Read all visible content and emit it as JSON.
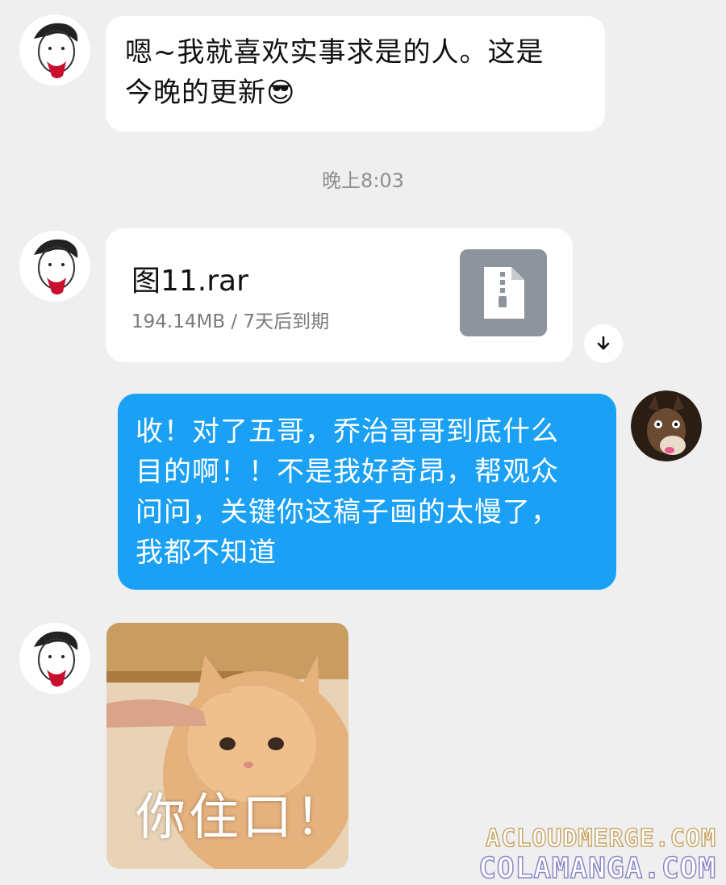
{
  "messages": {
    "m1": {
      "text_line1": "嗯~我就喜欢实事求是的人。这是",
      "text_line2": "今晚的更新",
      "emoji": "😎"
    },
    "timestamp": "晚上8:03",
    "file": {
      "name": "图11.rar",
      "meta": "194.14MB / 7天后到期",
      "icon": "zip-file-icon"
    },
    "m3": {
      "lines": [
        "收！对了五哥，乔治哥哥到底什么",
        "目的啊！！不是我好奇昂，帮观众",
        "问问，关键你这稿子画的太慢了，",
        "我都不知道"
      ]
    },
    "sticker": {
      "caption": "你住口！"
    }
  },
  "watermarks": {
    "line1": "ACLOUDMERGE.COM",
    "line2": "COLAMANGA.COM"
  },
  "colors": {
    "background": "#efefef",
    "outgoing_bubble": "#1aa0f5",
    "incoming_bubble": "#ffffff"
  }
}
